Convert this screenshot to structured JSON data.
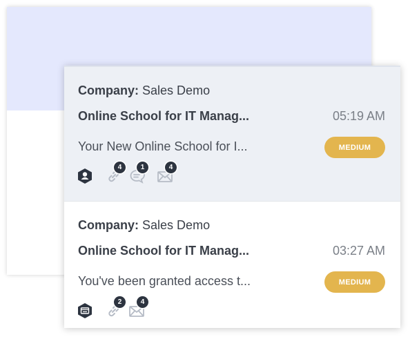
{
  "cards": [
    {
      "company_label": "Company:",
      "company_name": "Sales Demo",
      "subject": "Online School for IT Manag...",
      "time": "05:19 AM",
      "preview": "Your New Online School for I...",
      "priority": "MEDIUM",
      "avatar_icon": "user-hexagon-icon",
      "counts": {
        "links": "4",
        "comments": "1",
        "emails": "4"
      }
    },
    {
      "company_label": "Company:",
      "company_name": "Sales Demo",
      "subject": "Online School for IT Manag...",
      "time": "03:27 AM",
      "preview": "You've been granted access t...",
      "priority": "MEDIUM",
      "avatar_icon": "web-hexagon-icon",
      "counts": {
        "links": "2",
        "emails": "4"
      }
    }
  ],
  "colors": {
    "badge": "#e3b54e",
    "active_card": "#edf0f5",
    "count_bubble": "#2d3440",
    "background_panel": "#e4e8fd"
  }
}
